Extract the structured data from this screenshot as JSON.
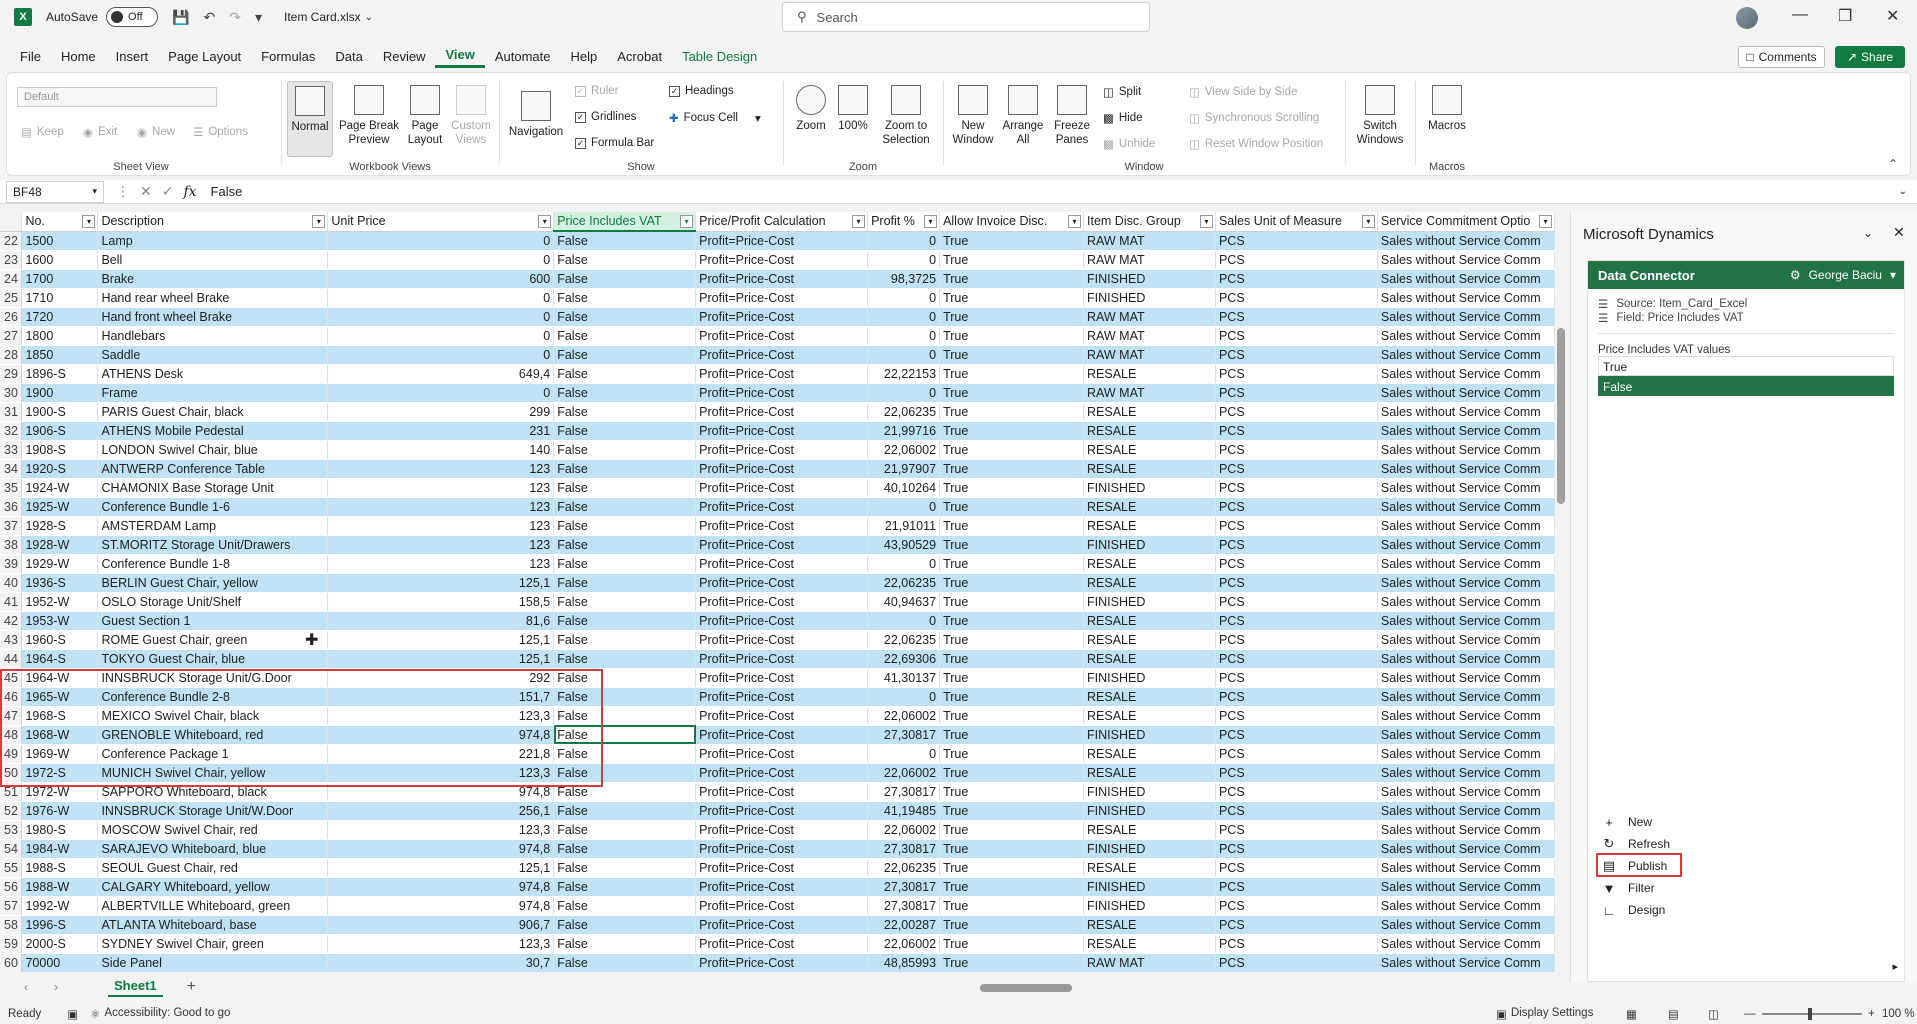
{
  "titlebar": {
    "autosave_label": "AutoSave",
    "autosave_state": "Off",
    "filename": "Item Card.xlsx",
    "search_placeholder": "Search"
  },
  "menu": {
    "items": [
      "File",
      "Home",
      "Insert",
      "Page Layout",
      "Formulas",
      "Data",
      "Review",
      "View",
      "Automate",
      "Help",
      "Acrobat",
      "Table Design"
    ],
    "active": "View",
    "comments": "Comments",
    "share": "Share"
  },
  "ribbon": {
    "sheetview_default": "Default",
    "sheetview_buttons": [
      "Keep",
      "Exit",
      "New",
      "Options"
    ],
    "sheetview_label": "Sheet View",
    "workbook_views": {
      "normal": "Normal",
      "page_break": "Page Break Preview",
      "page_layout": "Page Layout",
      "custom": "Custom Views",
      "label": "Workbook Views"
    },
    "show": {
      "navigation": "Navigation",
      "ruler": "Ruler",
      "gridlines": "Gridlines",
      "formula_bar": "Formula Bar",
      "headings": "Headings",
      "focus_cell": "Focus Cell",
      "label": "Show"
    },
    "zoom": {
      "zoom": "Zoom",
      "hundred": "100%",
      "zoom_selection": "Zoom to Selection",
      "label": "Zoom"
    },
    "window": {
      "new_window": "New Window",
      "arrange_all": "Arrange All",
      "freeze_panes": "Freeze Panes",
      "split": "Split",
      "hide": "Hide",
      "unhide": "Unhide",
      "view_side": "View Side by Side",
      "sync_scroll": "Synchronous Scrolling",
      "reset_pos": "Reset Window Position",
      "switch_windows": "Switch Windows",
      "label": "Window"
    },
    "macros": {
      "macros": "Macros",
      "label": "Macros"
    }
  },
  "formula_bar": {
    "cell_ref": "BF48",
    "value": "False"
  },
  "table": {
    "headers": [
      "No.",
      "Description",
      "Unit Price",
      "Price Includes VAT",
      "Price/Profit Calculation",
      "Profit %",
      "Allow Invoice Disc.",
      "Item Disc. Group",
      "Sales Unit of Measure",
      "Service Commitment Optio"
    ],
    "rows": [
      [
        "22",
        "1500",
        "Lamp",
        "0",
        "False",
        "Profit=Price-Cost",
        "0",
        "True",
        "RAW MAT",
        "PCS",
        "Sales without Service Comm"
      ],
      [
        "23",
        "1600",
        "Bell",
        "0",
        "False",
        "Profit=Price-Cost",
        "0",
        "True",
        "RAW MAT",
        "PCS",
        "Sales without Service Comm"
      ],
      [
        "24",
        "1700",
        "Brake",
        "600",
        "False",
        "Profit=Price-Cost",
        "98,3725",
        "True",
        "FINISHED",
        "PCS",
        "Sales without Service Comm"
      ],
      [
        "25",
        "1710",
        "Hand rear wheel Brake",
        "0",
        "False",
        "Profit=Price-Cost",
        "0",
        "True",
        "FINISHED",
        "PCS",
        "Sales without Service Comm"
      ],
      [
        "26",
        "1720",
        "Hand front wheel Brake",
        "0",
        "False",
        "Profit=Price-Cost",
        "0",
        "True",
        "RAW MAT",
        "PCS",
        "Sales without Service Comm"
      ],
      [
        "27",
        "1800",
        "Handlebars",
        "0",
        "False",
        "Profit=Price-Cost",
        "0",
        "True",
        "RAW MAT",
        "PCS",
        "Sales without Service Comm"
      ],
      [
        "28",
        "1850",
        "Saddle",
        "0",
        "False",
        "Profit=Price-Cost",
        "0",
        "True",
        "RAW MAT",
        "PCS",
        "Sales without Service Comm"
      ],
      [
        "29",
        "1896-S",
        "ATHENS Desk",
        "649,4",
        "False",
        "Profit=Price-Cost",
        "22,22153",
        "True",
        "RESALE",
        "PCS",
        "Sales without Service Comm"
      ],
      [
        "30",
        "1900",
        "Frame",
        "0",
        "False",
        "Profit=Price-Cost",
        "0",
        "True",
        "RAW MAT",
        "PCS",
        "Sales without Service Comm"
      ],
      [
        "31",
        "1900-S",
        "PARIS Guest Chair, black",
        "299",
        "False",
        "Profit=Price-Cost",
        "22,06235",
        "True",
        "RESALE",
        "PCS",
        "Sales without Service Comm"
      ],
      [
        "32",
        "1906-S",
        "ATHENS Mobile Pedestal",
        "231",
        "False",
        "Profit=Price-Cost",
        "21,99716",
        "True",
        "RESALE",
        "PCS",
        "Sales without Service Comm"
      ],
      [
        "33",
        "1908-S",
        "LONDON Swivel Chair, blue",
        "140",
        "False",
        "Profit=Price-Cost",
        "22,06002",
        "True",
        "RESALE",
        "PCS",
        "Sales without Service Comm"
      ],
      [
        "34",
        "1920-S",
        "ANTWERP Conference Table",
        "123",
        "False",
        "Profit=Price-Cost",
        "21,97907",
        "True",
        "RESALE",
        "PCS",
        "Sales without Service Comm"
      ],
      [
        "35",
        "1924-W",
        "CHAMONIX Base Storage Unit",
        "123",
        "False",
        "Profit=Price-Cost",
        "40,10264",
        "True",
        "FINISHED",
        "PCS",
        "Sales without Service Comm"
      ],
      [
        "36",
        "1925-W",
        "Conference Bundle 1-6",
        "123",
        "False",
        "Profit=Price-Cost",
        "0",
        "True",
        "RESALE",
        "PCS",
        "Sales without Service Comm"
      ],
      [
        "37",
        "1928-S",
        "AMSTERDAM Lamp",
        "123",
        "False",
        "Profit=Price-Cost",
        "21,91011",
        "True",
        "RESALE",
        "PCS",
        "Sales without Service Comm"
      ],
      [
        "38",
        "1928-W",
        "ST.MORITZ Storage Unit/Drawers",
        "123",
        "False",
        "Profit=Price-Cost",
        "43,90529",
        "True",
        "FINISHED",
        "PCS",
        "Sales without Service Comm"
      ],
      [
        "39",
        "1929-W",
        "Conference Bundle 1-8",
        "123",
        "False",
        "Profit=Price-Cost",
        "0",
        "True",
        "RESALE",
        "PCS",
        "Sales without Service Comm"
      ],
      [
        "40",
        "1936-S",
        "BERLIN Guest Chair, yellow",
        "125,1",
        "False",
        "Profit=Price-Cost",
        "22,06235",
        "True",
        "RESALE",
        "PCS",
        "Sales without Service Comm"
      ],
      [
        "41",
        "1952-W",
        "OSLO Storage Unit/Shelf",
        "158,5",
        "False",
        "Profit=Price-Cost",
        "40,94637",
        "True",
        "FINISHED",
        "PCS",
        "Sales without Service Comm"
      ],
      [
        "42",
        "1953-W",
        "Guest Section 1",
        "81,6",
        "False",
        "Profit=Price-Cost",
        "0",
        "True",
        "RESALE",
        "PCS",
        "Sales without Service Comm"
      ],
      [
        "43",
        "1960-S",
        "ROME Guest Chair, green",
        "125,1",
        "False",
        "Profit=Price-Cost",
        "22,06235",
        "True",
        "RESALE",
        "PCS",
        "Sales without Service Comm"
      ],
      [
        "44",
        "1964-S",
        "TOKYO Guest Chair, blue",
        "125,1",
        "False",
        "Profit=Price-Cost",
        "22,69306",
        "True",
        "RESALE",
        "PCS",
        "Sales without Service Comm"
      ],
      [
        "45",
        "1964-W",
        "INNSBRUCK Storage Unit/G.Door",
        "292",
        "False",
        "Profit=Price-Cost",
        "41,30137",
        "True",
        "FINISHED",
        "PCS",
        "Sales without Service Comm"
      ],
      [
        "46",
        "1965-W",
        "Conference Bundle 2-8",
        "151,7",
        "False",
        "Profit=Price-Cost",
        "0",
        "True",
        "RESALE",
        "PCS",
        "Sales without Service Comm"
      ],
      [
        "47",
        "1968-S",
        "MEXICO Swivel Chair, black",
        "123,3",
        "False",
        "Profit=Price-Cost",
        "22,06002",
        "True",
        "RESALE",
        "PCS",
        "Sales without Service Comm"
      ],
      [
        "48",
        "1968-W",
        "GRENOBLE Whiteboard, red",
        "974,8",
        "False",
        "Profit=Price-Cost",
        "27,30817",
        "True",
        "FINISHED",
        "PCS",
        "Sales without Service Comm"
      ],
      [
        "49",
        "1969-W",
        "Conference Package 1",
        "221,8",
        "False",
        "Profit=Price-Cost",
        "0",
        "True",
        "RESALE",
        "PCS",
        "Sales without Service Comm"
      ],
      [
        "50",
        "1972-S",
        "MUNICH Swivel Chair, yellow",
        "123,3",
        "False",
        "Profit=Price-Cost",
        "22,06002",
        "True",
        "RESALE",
        "PCS",
        "Sales without Service Comm"
      ],
      [
        "51",
        "1972-W",
        "SAPPORO Whiteboard, black",
        "974,8",
        "False",
        "Profit=Price-Cost",
        "27,30817",
        "True",
        "FINISHED",
        "PCS",
        "Sales without Service Comm"
      ],
      [
        "52",
        "1976-W",
        "INNSBRUCK Storage Unit/W.Door",
        "256,1",
        "False",
        "Profit=Price-Cost",
        "41,19485",
        "True",
        "FINISHED",
        "PCS",
        "Sales without Service Comm"
      ],
      [
        "53",
        "1980-S",
        "MOSCOW Swivel Chair, red",
        "123,3",
        "False",
        "Profit=Price-Cost",
        "22,06002",
        "True",
        "RESALE",
        "PCS",
        "Sales without Service Comm"
      ],
      [
        "54",
        "1984-W",
        "SARAJEVO Whiteboard, blue",
        "974,8",
        "False",
        "Profit=Price-Cost",
        "27,30817",
        "True",
        "FINISHED",
        "PCS",
        "Sales without Service Comm"
      ],
      [
        "55",
        "1988-S",
        "SEOUL Guest Chair, red",
        "125,1",
        "False",
        "Profit=Price-Cost",
        "22,06235",
        "True",
        "RESALE",
        "PCS",
        "Sales without Service Comm"
      ],
      [
        "56",
        "1988-W",
        "CALGARY Whiteboard, yellow",
        "974,8",
        "False",
        "Profit=Price-Cost",
        "27,30817",
        "True",
        "FINISHED",
        "PCS",
        "Sales without Service Comm"
      ],
      [
        "57",
        "1992-W",
        "ALBERTVILLE Whiteboard, green",
        "974,8",
        "False",
        "Profit=Price-Cost",
        "27,30817",
        "True",
        "FINISHED",
        "PCS",
        "Sales without Service Comm"
      ],
      [
        "58",
        "1996-S",
        "ATLANTA Whiteboard, base",
        "906,7",
        "False",
        "Profit=Price-Cost",
        "22,00287",
        "True",
        "RESALE",
        "PCS",
        "Sales without Service Comm"
      ],
      [
        "59",
        "2000-S",
        "SYDNEY Swivel Chair, green",
        "123,3",
        "False",
        "Profit=Price-Cost",
        "22,06002",
        "True",
        "RESALE",
        "PCS",
        "Sales without Service Comm"
      ],
      [
        "60",
        "70000",
        "Side Panel",
        "30,7",
        "False",
        "Profit=Price-Cost",
        "48,85993",
        "True",
        "RAW MAT",
        "PCS",
        "Sales without Service Comm"
      ]
    ]
  },
  "sheet": {
    "tab": "Sheet1"
  },
  "status": {
    "ready": "Ready",
    "accessibility": "Accessibility: Good to go",
    "display_settings": "Display Settings",
    "zoom": "100 %"
  },
  "panel": {
    "title": "Microsoft Dynamics",
    "connector": "Data Connector",
    "user": "George Baciu",
    "source": "Source: Item_Card_Excel",
    "field": "Field: Price Includes VAT",
    "values_label": "Price Includes VAT values",
    "values": [
      "True",
      "False"
    ],
    "selected_value": "False",
    "actions": [
      "New",
      "Refresh",
      "Publish",
      "Filter",
      "Design"
    ]
  },
  "colors": {
    "accent": "#107c41",
    "band": "#bfe3f4",
    "highlight": "#d83b3b"
  }
}
